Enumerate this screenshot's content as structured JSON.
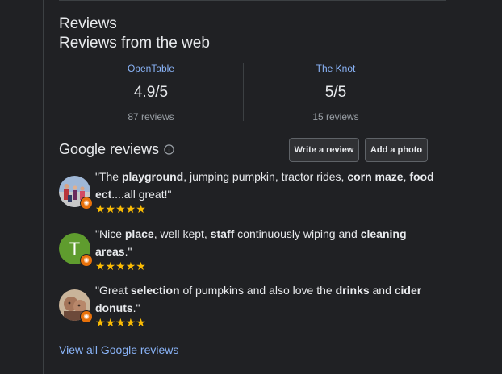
{
  "reviews_header": {
    "title": "Reviews",
    "subtitle": "Reviews from the web"
  },
  "web_reviews": [
    {
      "source": "OpenTable",
      "rating": "4.9/5",
      "count": "87 reviews"
    },
    {
      "source": "The Knot",
      "rating": "5/5",
      "count": "15 reviews"
    }
  ],
  "google_reviews": {
    "title": "Google reviews",
    "info_icon": "info-icon",
    "write_label": "Write a review",
    "photo_label": "Add a photo",
    "items": [
      {
        "avatar": "photo-avatar",
        "stars": "★★★★★",
        "rating": 5,
        "parts": [
          {
            "text": "\"The ",
            "bold": false
          },
          {
            "text": "playground",
            "bold": true
          },
          {
            "text": ", jumping pumpkin, tractor rides, ",
            "bold": false
          },
          {
            "text": "corn maze",
            "bold": true
          },
          {
            "text": ", ",
            "bold": false
          },
          {
            "text": "food ect",
            "bold": true
          },
          {
            "text": "....all great!\"",
            "bold": false
          }
        ]
      },
      {
        "avatar": "letter-avatar",
        "avatar_letter": "T",
        "stars": "★★★★★",
        "rating": 5,
        "parts": [
          {
            "text": "\"Nice ",
            "bold": false
          },
          {
            "text": "place",
            "bold": true
          },
          {
            "text": ", well kept, ",
            "bold": false
          },
          {
            "text": "staff",
            "bold": true
          },
          {
            "text": " continuously wiping and ",
            "bold": false
          },
          {
            "text": "cleaning areas",
            "bold": true
          },
          {
            "text": ".\"",
            "bold": false
          }
        ]
      },
      {
        "avatar": "photo-avatar",
        "stars": "★★★★★",
        "rating": 5,
        "parts": [
          {
            "text": "\"Great ",
            "bold": false
          },
          {
            "text": "selection",
            "bold": true
          },
          {
            "text": " of pumpkins and also love the ",
            "bold": false
          },
          {
            "text": "drinks",
            "bold": true
          },
          {
            "text": " and ",
            "bold": false
          },
          {
            "text": "cider donuts",
            "bold": true
          },
          {
            "text": ".\"",
            "bold": false
          }
        ]
      }
    ],
    "view_all_label": "View all Google reviews"
  },
  "colors": {
    "background": "#202124",
    "link": "#8ab4f8",
    "star": "#fbbc04",
    "badge": "#e8710a",
    "letter_avatar": "#5f9c2e"
  }
}
